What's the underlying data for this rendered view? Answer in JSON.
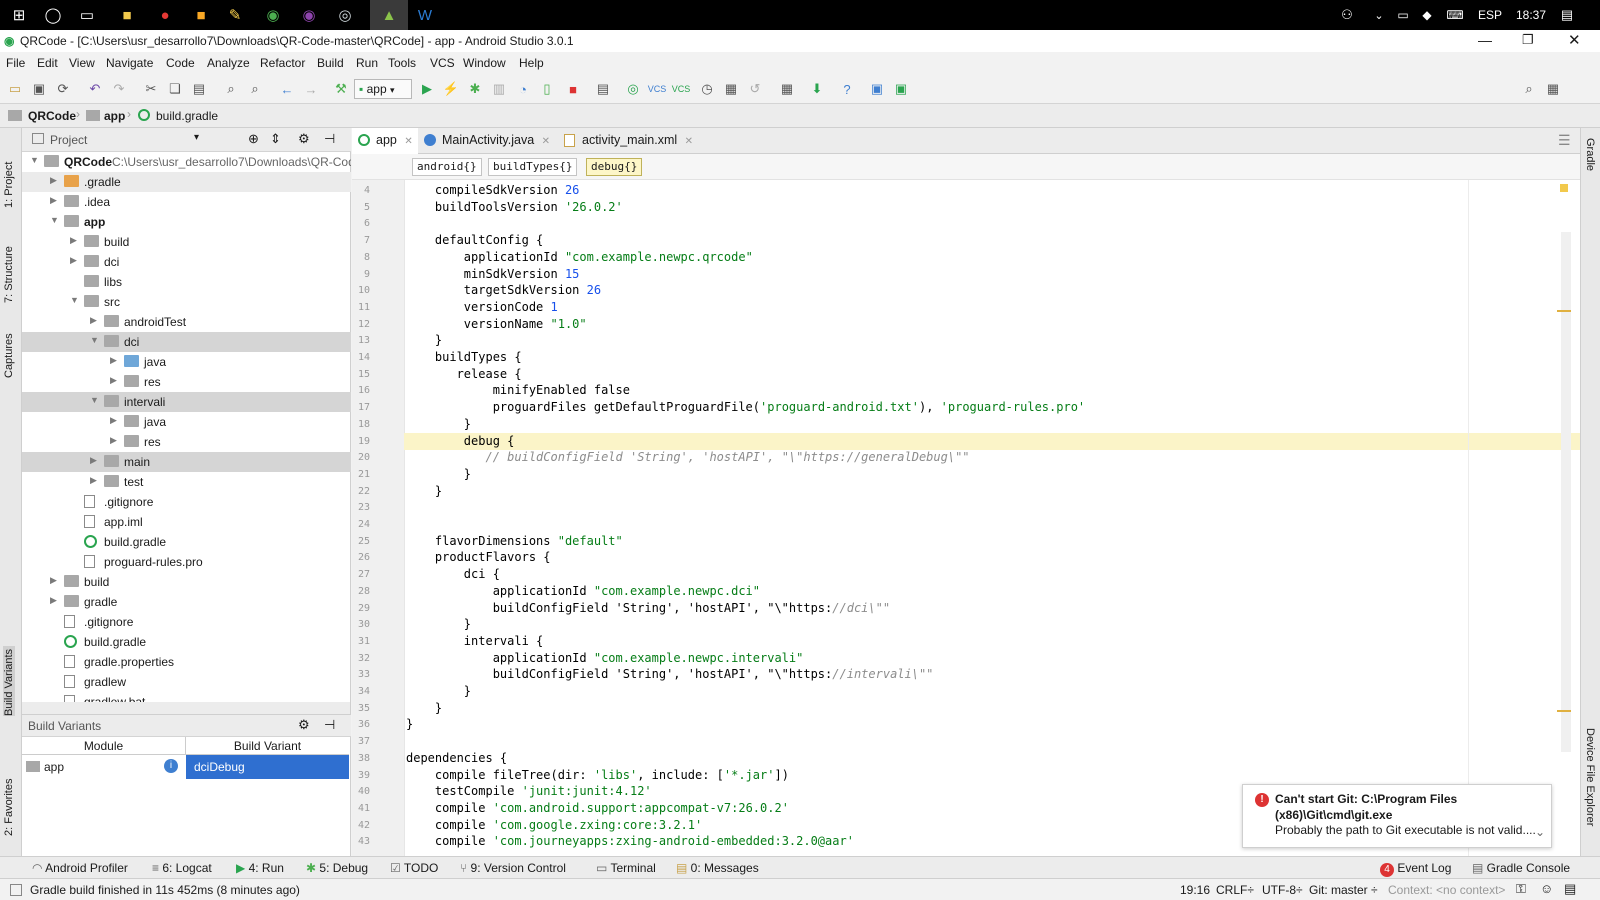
{
  "taskbar": {
    "icons": [
      "windows-logo-icon",
      "cortana-icon",
      "task-view-icon",
      "file-explorer-icon",
      "opera-icon",
      "sticky-icon",
      "paint-icon",
      "chrome-icon",
      "tor-icon",
      "vpn-icon",
      "android-studio-icon",
      "word-icon"
    ],
    "lang": "ESP",
    "time": "18:37"
  },
  "window": {
    "title": "QRCode - [C:\\Users\\usr_desarrollo7\\Downloads\\QR-Code-master\\QRCode] - app - Android Studio 3.0.1"
  },
  "menu": [
    "File",
    "Edit",
    "View",
    "Navigate",
    "Code",
    "Analyze",
    "Refactor",
    "Build",
    "Run",
    "Tools",
    "VCS",
    "Window",
    "Help"
  ],
  "toolbar": {
    "config": "app"
  },
  "breadcrumbs": [
    "QRCode",
    "app",
    "build.gradle"
  ],
  "project_panel": {
    "title": "Project",
    "rows": [
      {
        "label": "QRCode",
        "path": "C:\\Users\\usr_desarrollo7\\Downloads\\QR-Code",
        "indent": 0,
        "exp": "open",
        "icon": "folder"
      },
      {
        "label": ".gradle",
        "indent": 1,
        "exp": "closed",
        "icon": "folder-orange"
      },
      {
        "label": ".idea",
        "indent": 1,
        "exp": "closed",
        "icon": "folder"
      },
      {
        "label": "app",
        "indent": 1,
        "exp": "open",
        "icon": "folder"
      },
      {
        "label": "build",
        "indent": 2,
        "exp": "closed",
        "icon": "folder"
      },
      {
        "label": "dci",
        "indent": 2,
        "exp": "closed",
        "icon": "folder"
      },
      {
        "label": "libs",
        "indent": 2,
        "exp": "none",
        "icon": "folder"
      },
      {
        "label": "src",
        "indent": 2,
        "exp": "open",
        "icon": "folder"
      },
      {
        "label": "androidTest",
        "indent": 3,
        "exp": "closed",
        "icon": "folder"
      },
      {
        "label": "dci",
        "indent": 3,
        "exp": "open",
        "icon": "folder",
        "sel": true
      },
      {
        "label": "java",
        "indent": 4,
        "exp": "closed",
        "icon": "folder-blue"
      },
      {
        "label": "res",
        "indent": 4,
        "exp": "closed",
        "icon": "folder"
      },
      {
        "label": "intervali",
        "indent": 3,
        "exp": "open",
        "icon": "folder",
        "sel": true
      },
      {
        "label": "java",
        "indent": 4,
        "exp": "closed",
        "icon": "folder"
      },
      {
        "label": "res",
        "indent": 4,
        "exp": "closed",
        "icon": "folder"
      },
      {
        "label": "main",
        "indent": 3,
        "exp": "closed",
        "icon": "folder",
        "sel": true
      },
      {
        "label": "test",
        "indent": 3,
        "exp": "closed",
        "icon": "folder"
      },
      {
        "label": ".gitignore",
        "indent": 2,
        "exp": "none",
        "icon": "file"
      },
      {
        "label": "app.iml",
        "indent": 2,
        "exp": "none",
        "icon": "file"
      },
      {
        "label": "build.gradle",
        "indent": 2,
        "exp": "none",
        "icon": "gradle"
      },
      {
        "label": "proguard-rules.pro",
        "indent": 2,
        "exp": "none",
        "icon": "file"
      },
      {
        "label": "build",
        "indent": 1,
        "exp": "closed",
        "icon": "folder"
      },
      {
        "label": "gradle",
        "indent": 1,
        "exp": "closed",
        "icon": "folder"
      },
      {
        "label": ".gitignore",
        "indent": 1,
        "exp": "none",
        "icon": "file"
      },
      {
        "label": "build.gradle",
        "indent": 1,
        "exp": "none",
        "icon": "gradle"
      },
      {
        "label": "gradle.properties",
        "indent": 1,
        "exp": "none",
        "icon": "file"
      },
      {
        "label": "gradlew",
        "indent": 1,
        "exp": "none",
        "icon": "file"
      },
      {
        "label": "gradlew.bat",
        "indent": 1,
        "exp": "none",
        "icon": "file"
      }
    ]
  },
  "build_variants": {
    "title": "Build Variants",
    "col_module": "Module",
    "col_variant": "Build Variant",
    "module": "app",
    "variant": "dciDebug"
  },
  "left_tabs": [
    "1: Project",
    "7: Structure",
    "Captures",
    "Build Variants",
    "2: Favorites"
  ],
  "right_tabs": [
    "Gradle",
    "Device File Explorer"
  ],
  "editor": {
    "tabs": [
      "app",
      "MainActivity.java",
      "activity_main.xml"
    ],
    "crumbs": [
      "android{}",
      "buildTypes{}",
      "debug{}"
    ],
    "lines": [
      {
        "n": "4",
        "t": "    compileSdkVersion 26"
      },
      {
        "n": "5",
        "t": "    buildToolsVersion '26.0.2'"
      },
      {
        "n": "6",
        "t": ""
      },
      {
        "n": "7",
        "t": "    defaultConfig {"
      },
      {
        "n": "8",
        "t": "        applicationId \"com.example.newpc.qrcode\""
      },
      {
        "n": "9",
        "t": "        minSdkVersion 15"
      },
      {
        "n": "10",
        "t": "        targetSdkVersion 26"
      },
      {
        "n": "11",
        "t": "        versionCode 1"
      },
      {
        "n": "12",
        "t": "        versionName \"1.0\""
      },
      {
        "n": "13",
        "t": "    }"
      },
      {
        "n": "14",
        "t": "    buildTypes {"
      },
      {
        "n": "15",
        "t": "       release {"
      },
      {
        "n": "16",
        "t": "            minifyEnabled false"
      },
      {
        "n": "17",
        "t": "            proguardFiles getDefaultProguardFile('proguard-android.txt'), 'proguard-rules.pro'"
      },
      {
        "n": "18",
        "t": "        }"
      },
      {
        "n": "19",
        "t": "        debug {"
      },
      {
        "n": "20",
        "t": "           // buildConfigField 'String', 'hostAPI', \"\\\"https://generalDebug\\\"\""
      },
      {
        "n": "21",
        "t": "        }"
      },
      {
        "n": "22",
        "t": "    }"
      },
      {
        "n": "23",
        "t": ""
      },
      {
        "n": "24",
        "t": ""
      },
      {
        "n": "25",
        "t": "    flavorDimensions \"default\""
      },
      {
        "n": "26",
        "t": "    productFlavors {"
      },
      {
        "n": "27",
        "t": "        dci {"
      },
      {
        "n": "28",
        "t": "            applicationId \"com.example.newpc.dci\""
      },
      {
        "n": "29",
        "t": "            buildConfigField 'String', 'hostAPI', \"\\\"https://dci\\\"\""
      },
      {
        "n": "30",
        "t": "        }"
      },
      {
        "n": "31",
        "t": "        intervali {"
      },
      {
        "n": "32",
        "t": "            applicationId \"com.example.newpc.intervali\""
      },
      {
        "n": "33",
        "t": "            buildConfigField 'String', 'hostAPI', \"\\\"https://intervali\\\"\""
      },
      {
        "n": "34",
        "t": "        }"
      },
      {
        "n": "35",
        "t": "    }"
      },
      {
        "n": "36",
        "t": "}"
      },
      {
        "n": "37",
        "t": ""
      },
      {
        "n": "38",
        "t": "dependencies {"
      },
      {
        "n": "39",
        "t": "    compile fileTree(dir: 'libs', include: ['*.jar'])"
      },
      {
        "n": "40",
        "t": "    testCompile 'junit:junit:4.12'"
      },
      {
        "n": "41",
        "t": "    compile 'com.android.support:appcompat-v7:26.0.2'"
      },
      {
        "n": "42",
        "t": "    compile 'com.google.zxing:core:3.2.1'"
      },
      {
        "n": "43",
        "t": "    compile 'com.journeyapps:zxing-android-embedded:3.2.0@aar'"
      }
    ]
  },
  "notification": {
    "title": "Can't start Git: C:\\Program Files (x86)\\Git\\cmd\\git.exe",
    "body": "Probably the path to Git executable is not valid...."
  },
  "tool_windows": {
    "left": [
      "Android Profiler",
      "6: Logcat",
      "4: Run",
      "5: Debug",
      "TODO",
      "9: Version Control",
      "Terminal",
      "0: Messages"
    ],
    "right": [
      "Event Log",
      "Gradle Console"
    ],
    "event_badge": "4"
  },
  "status": {
    "message": "Gradle build finished in 11s 452ms (8 minutes ago)",
    "position": "19:16",
    "line_sep": "CRLF÷",
    "encoding": "UTF-8÷",
    "git": "Git: master ÷",
    "context": "Context: <no context>"
  }
}
